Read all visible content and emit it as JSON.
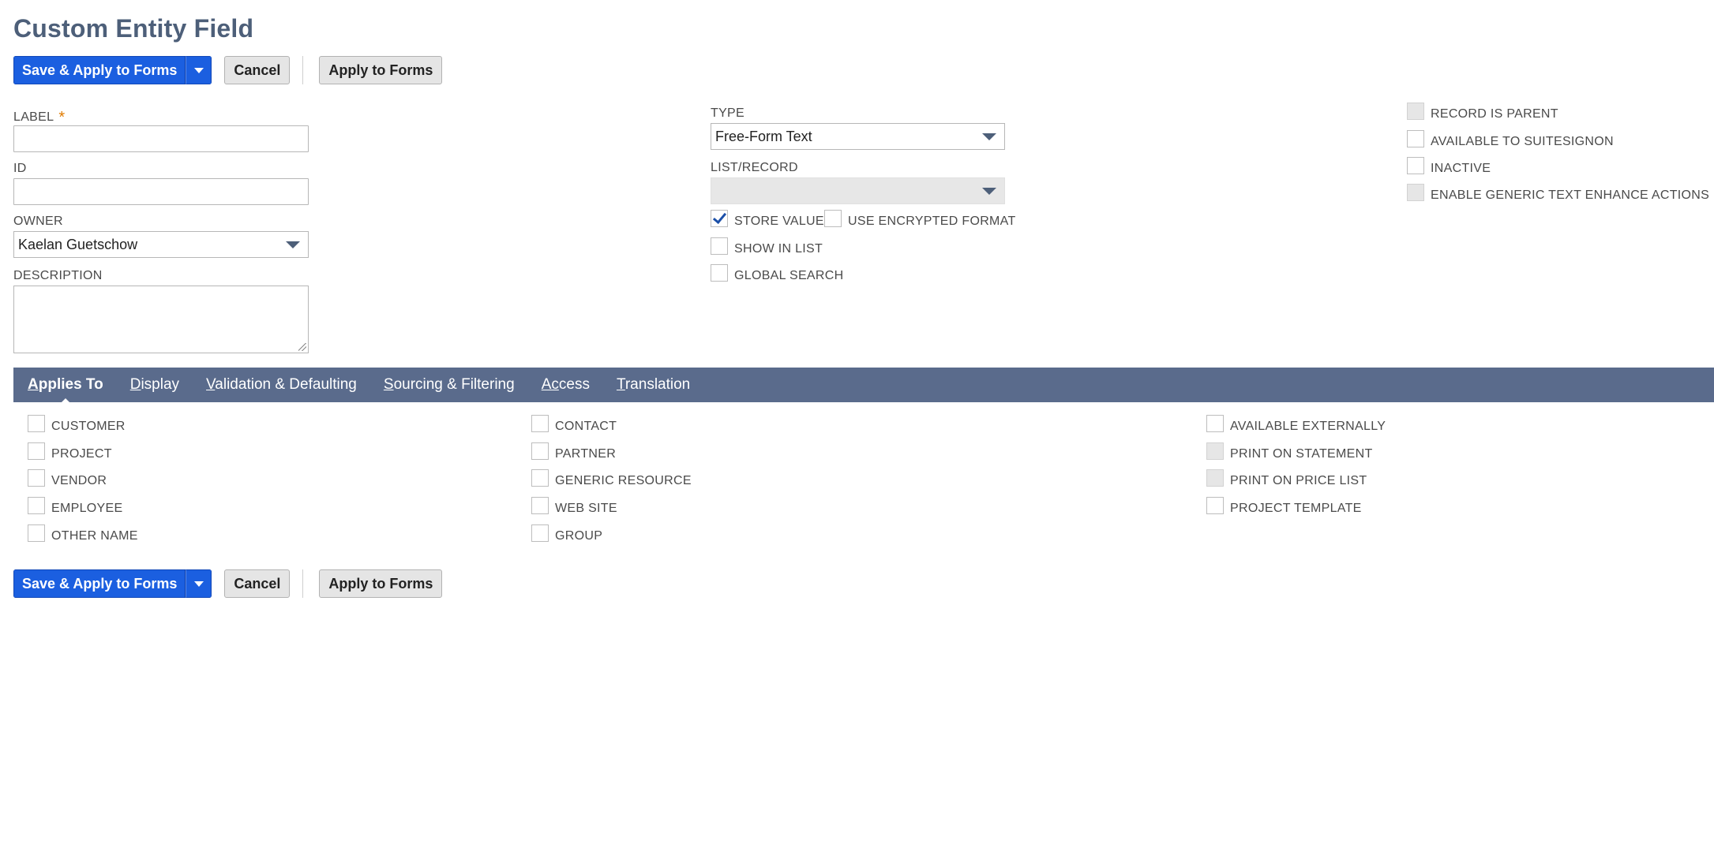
{
  "page": {
    "title": "Custom Entity Field"
  },
  "toolbar": {
    "save_label": "Save & Apply to Forms",
    "cancel_label": "Cancel",
    "apply_label": "Apply to Forms"
  },
  "fields": {
    "label": {
      "label": "LABEL",
      "required_mark": "*",
      "value": ""
    },
    "id": {
      "label": "ID",
      "value": ""
    },
    "owner": {
      "label": "OWNER",
      "value": "Kaelan Guetschow"
    },
    "description": {
      "label": "DESCRIPTION",
      "value": ""
    },
    "type": {
      "label": "TYPE",
      "value": "Free-Form Text"
    },
    "list_record": {
      "label": "LIST/RECORD",
      "value": ""
    }
  },
  "options_middle": [
    {
      "label": "STORE VALUE",
      "checked": true
    },
    {
      "label": "USE ENCRYPTED FORMAT",
      "checked": false
    },
    {
      "label": "SHOW IN LIST",
      "checked": false
    },
    {
      "label": "GLOBAL SEARCH",
      "checked": false
    }
  ],
  "options_right": [
    {
      "label": "RECORD IS PARENT",
      "checked": false,
      "disabled": true
    },
    {
      "label": "AVAILABLE TO SUITESIGNON",
      "checked": false,
      "disabled": false
    },
    {
      "label": "INACTIVE",
      "checked": false,
      "disabled": false
    },
    {
      "label": "ENABLE GENERIC TEXT ENHANCE ACTIONS",
      "checked": false,
      "disabled": true
    }
  ],
  "tabs": [
    {
      "first": "A",
      "rest": "pplies To",
      "active": true
    },
    {
      "first": "D",
      "rest": "isplay",
      "active": false
    },
    {
      "first": "V",
      "rest": "alidation & Defaulting",
      "active": false
    },
    {
      "first": "S",
      "rest": "ourcing & Filtering",
      "active": false
    },
    {
      "first": "Ac",
      "rest": "cess",
      "active": false
    },
    {
      "first": "T",
      "rest": "ranslation",
      "active": false
    }
  ],
  "applies_to": {
    "col1": [
      {
        "label": "CUSTOMER",
        "checked": false
      },
      {
        "label": "PROJECT",
        "checked": false
      },
      {
        "label": "VENDOR",
        "checked": false
      },
      {
        "label": "EMPLOYEE",
        "checked": false
      },
      {
        "label": "OTHER NAME",
        "checked": false
      }
    ],
    "col2": [
      {
        "label": "CONTACT",
        "checked": false
      },
      {
        "label": "PARTNER",
        "checked": false
      },
      {
        "label": "GENERIC RESOURCE",
        "checked": false
      },
      {
        "label": "WEB SITE",
        "checked": false
      },
      {
        "label": "GROUP",
        "checked": false
      }
    ],
    "col3": [
      {
        "label": "AVAILABLE EXTERNALLY",
        "checked": false,
        "disabled": false
      },
      {
        "label": "PRINT ON STATEMENT",
        "checked": false,
        "disabled": true
      },
      {
        "label": "PRINT ON PRICE LIST",
        "checked": false,
        "disabled": true
      },
      {
        "label": "PROJECT TEMPLATE",
        "checked": false,
        "disabled": false
      }
    ]
  }
}
